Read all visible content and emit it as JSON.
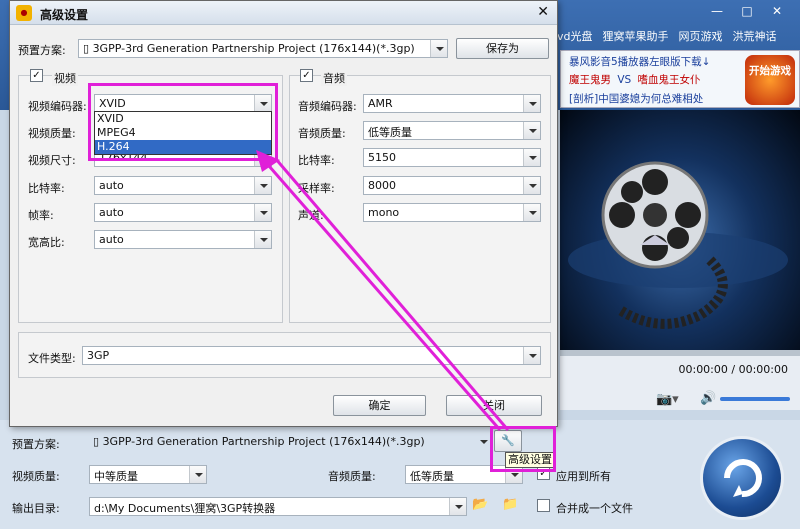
{
  "main_window": {
    "menu": [
      "vd光盘",
      "狸窝苹果助手",
      "网页游戏",
      "洪荒神话"
    ],
    "ad": {
      "line1": "暴风影音5播放器左眼版下载↓",
      "line2a": "魔王鬼男",
      "vs": "VS",
      "line2b": "嗜血鬼王女仆",
      "line3": "[剖析]中国婆媳为何总难相处",
      "button": "开始游戏"
    },
    "player": {
      "time": "00:00:00 / 00:00:00"
    },
    "bottom": {
      "preset_label": "预置方案:",
      "preset_value": "3GPP-3rd Generation Partnership Project (176x144)(*.3gp)",
      "tooltip": "高级设置",
      "video_quality_label": "视频质量:",
      "video_quality_value": "中等质量",
      "audio_quality_label": "音频质量:",
      "audio_quality_value": "低等质量",
      "apply_all_label": "应用到所有",
      "output_label": "输出目录:",
      "output_value": "d:\\My Documents\\狸窝\\3GP转换器",
      "merge_label": "合并成一个文件"
    }
  },
  "dialog": {
    "title": "高级设置",
    "preset_label": "预置方案:",
    "preset_value": "3GPP-3rd Generation Partnership Project (176x144)(*.3gp)",
    "save_as": "保存为",
    "video": {
      "title": "视频",
      "encoder_label": "视频编码器:",
      "encoder_value": "XVID",
      "encoder_options": [
        "XVID",
        "MPEG4",
        "H.264"
      ],
      "quality_label": "视频质量:",
      "size_label": "视频尺寸:",
      "size_value": "176x144",
      "bitrate_label": "比特率:",
      "bitrate_value": "auto",
      "fps_label": "帧率:",
      "fps_value": "auto",
      "aspect_label": "宽高比:",
      "aspect_value": "auto"
    },
    "audio": {
      "title": "音频",
      "encoder_label": "音频编码器:",
      "encoder_value": "AMR",
      "quality_label": "音频质量:",
      "quality_value": "低等质量",
      "bitrate_label": "比特率:",
      "bitrate_value": "5150",
      "samplerate_label": "采样率:",
      "samplerate_value": "8000",
      "channel_label": "声道:",
      "channel_value": "mono"
    },
    "filetype_label": "文件类型:",
    "filetype_value": "3GP",
    "ok": "确定",
    "close": "关闭"
  },
  "colors": {
    "highlight": "#e020d8",
    "selection": "#316ac5"
  }
}
